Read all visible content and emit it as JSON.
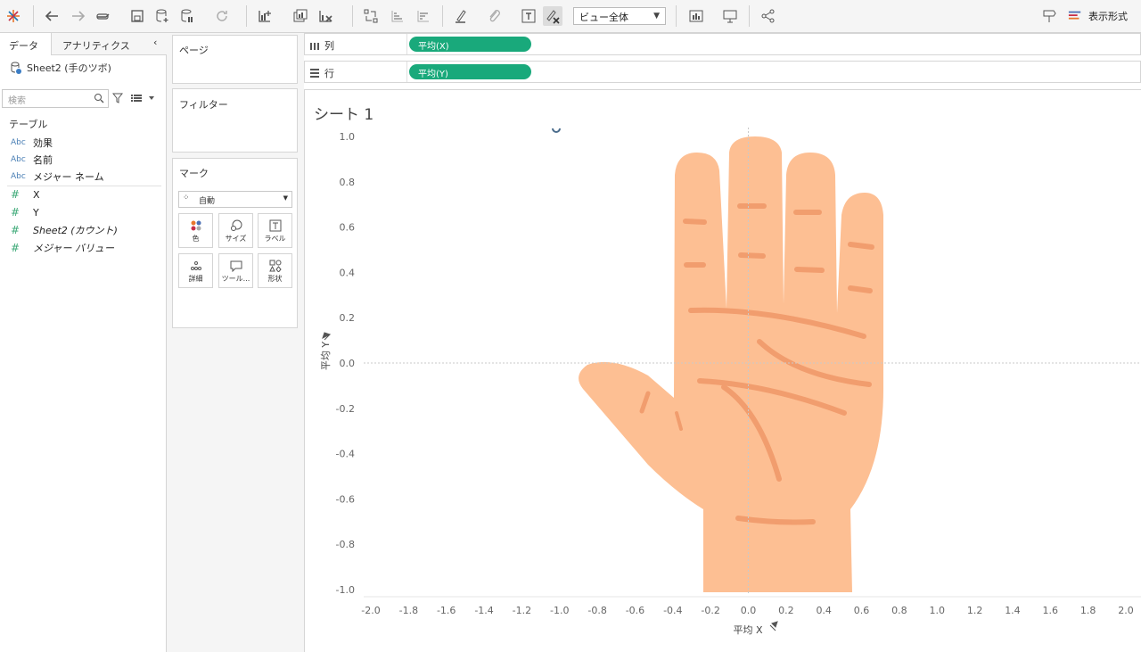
{
  "toolbar": {
    "fit_value": "ビュー全体",
    "show_me_label": "表示形式"
  },
  "left_pane": {
    "tab_data": "データ",
    "tab_analytics": "アナリティクス",
    "datasource": "Sheet2 (手のツボ)",
    "search_placeholder": "検索",
    "section_label": "テーブル",
    "dimensions": [
      {
        "type": "Abc",
        "name": "効果"
      },
      {
        "type": "Abc",
        "name": "名前"
      },
      {
        "type": "Abc",
        "name": "メジャー ネーム"
      }
    ],
    "measures": [
      {
        "type": "#",
        "name": "X"
      },
      {
        "type": "#",
        "name": "Y"
      },
      {
        "type": "#",
        "name": "Sheet2 (カウント)"
      },
      {
        "type": "#",
        "name": "メジャー バリュー"
      }
    ]
  },
  "cards": {
    "pages": "ページ",
    "filters": "フィルター",
    "marks": "マーク",
    "marks_type": "自動",
    "buttons": [
      "色",
      "サイズ",
      "ラベル",
      "詳細",
      "ツール...",
      "形状"
    ]
  },
  "shelves": {
    "columns_label": "列",
    "columns_pill": "平均(X)",
    "rows_label": "行",
    "rows_pill": "平均(Y)"
  },
  "sheet": {
    "title": "シート 1"
  },
  "chart_data": {
    "type": "scatter",
    "title": "シート 1",
    "xlabel": "平均 X",
    "ylabel": "平均 Y",
    "xlim": [
      -2.0,
      2.0
    ],
    "ylim": [
      -1.0,
      1.0
    ],
    "xticks": [
      "-2.0",
      "-1.8",
      "-1.6",
      "-1.4",
      "-1.2",
      "-1.0",
      "-0.8",
      "-0.6",
      "-0.4",
      "-0.2",
      "0.0",
      "0.2",
      "0.4",
      "0.6",
      "0.8",
      "1.0",
      "1.2",
      "1.4",
      "1.6",
      "1.8",
      "2.0"
    ],
    "yticks": [
      "1.0",
      "0.8",
      "0.6",
      "0.4",
      "0.2",
      "0.0",
      "-0.2",
      "-0.4",
      "-0.6",
      "-0.8",
      "-1.0"
    ],
    "background_image": "hand-palm-illustration",
    "colors": {
      "hand": "#fdbf93",
      "lines": "#f09a6a",
      "mark": "#4a6c8c"
    }
  }
}
